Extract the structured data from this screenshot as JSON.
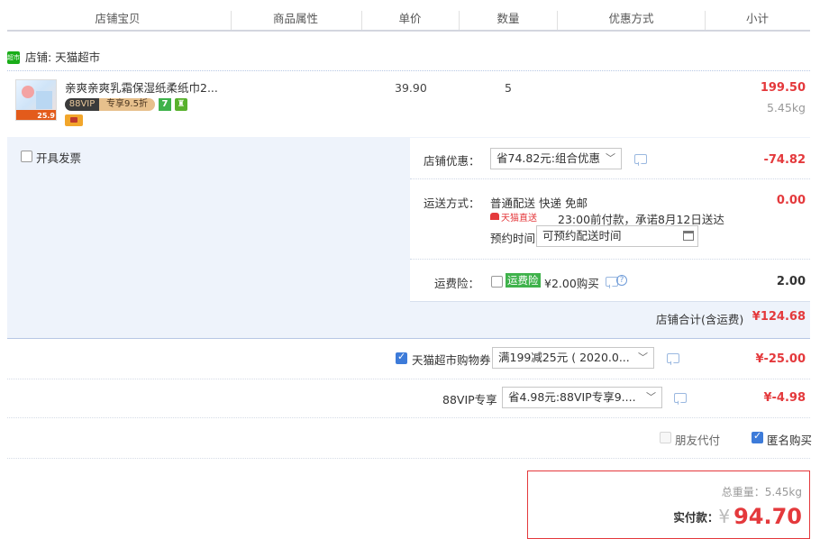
{
  "header": {
    "col_shop_item": "店铺宝贝",
    "col_attr": "商品属性",
    "col_price": "单价",
    "col_qty": "数量",
    "col_discount": "优惠方式",
    "col_subtotal": "小计"
  },
  "shop": {
    "icon_text": "超市",
    "label": "店铺: 天猫超市"
  },
  "item": {
    "title": "亲爽亲爽乳霜保湿纸柔纸巾2...",
    "thumb_price": "25.9",
    "vip_badge": "88VIP",
    "vip_discount": "专享9.5折",
    "badge_7": "7",
    "unit_price": "39.90",
    "quantity": "5",
    "subtotal": "199.50",
    "weight": "5.45kg"
  },
  "invoice": {
    "label": "开具发票",
    "checked": false
  },
  "shop_discount": {
    "label": "店铺优惠：",
    "selected": "省74.82元:组合优惠",
    "amount": "-74.82"
  },
  "shipping": {
    "label": "运送方式：",
    "method": "普通配送 快递 免邮",
    "tmall_badge": "天猫直送",
    "promise": "23:00前付款，承诺8月12日送达",
    "reserve_label": "预约时间",
    "reserve_placeholder": "可预约配送时间",
    "amount": "0.00"
  },
  "insurance": {
    "label": "运费险：",
    "badge": "运费险",
    "text": "¥2.00购买",
    "amount": "2.00",
    "checked": false
  },
  "shop_total": {
    "label": "店铺合计(含运费)",
    "amount": "¥124.68"
  },
  "coupon": {
    "label": "天猫超市购物券",
    "selected": "满199减25元 ( 2020.0...",
    "amount": "¥-25.00",
    "checked": true
  },
  "vip88": {
    "label": "88VIP专享",
    "selected": "省4.98元:88VIP专享9....",
    "amount": "¥-4.98"
  },
  "options": {
    "friend_pay": "朋友代付",
    "anonymous": "匿名购买",
    "anonymous_checked": true
  },
  "summary": {
    "weight_label": "总重量：",
    "weight": "5.45kg",
    "pay_label": "实付款：",
    "currency": "¥",
    "pay_amount": "94.70"
  },
  "colors": {
    "accent_red": "#e4393c",
    "panel_blue": "#eef3fb",
    "checkbox_blue": "#3d7bd9",
    "tmall_green": "#1aad19"
  }
}
